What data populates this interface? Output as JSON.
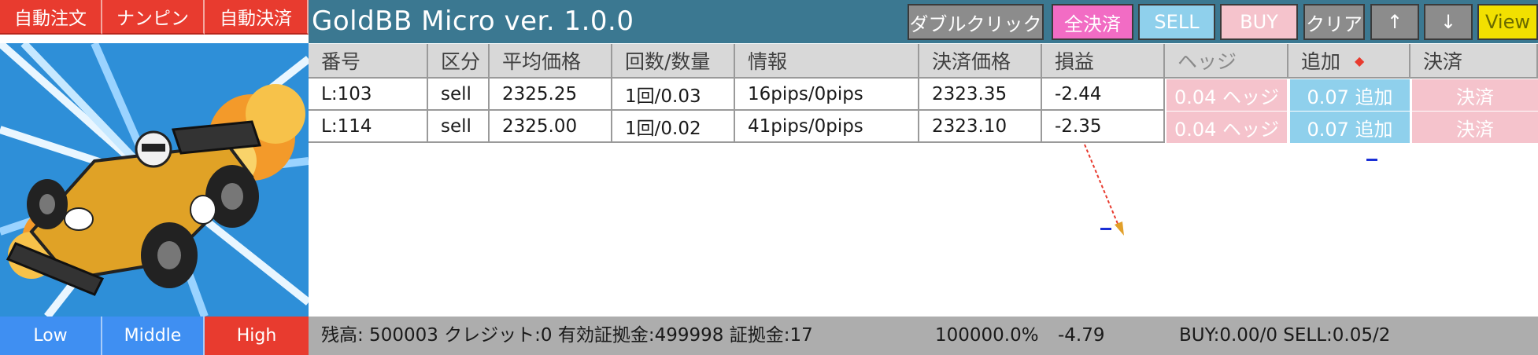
{
  "left_buttons": [
    "自動注文",
    "ナンピン",
    "自動決済"
  ],
  "title": "GoldBB Micro ver. 1.0.0",
  "toolbar": {
    "double_click": "ダブルクリック",
    "close_all": "全決済",
    "sell": "SELL",
    "buy": "BUY",
    "clear": "クリア",
    "up": "↑",
    "down": "↓",
    "view": "View"
  },
  "table": {
    "headers": [
      "番号",
      "区分",
      "平均価格",
      "回数/数量",
      "情報",
      "決済価格",
      "損益",
      "ヘッジ",
      "追加",
      "決済"
    ],
    "rows": [
      {
        "id": "L:103",
        "side": "sell",
        "avg_price": "2325.25",
        "count_qty": "1回/0.03",
        "info": "16pips/0pips",
        "close_price": "2323.35",
        "pnl": "-2.44",
        "hedge": "0.04 ヘッジ",
        "add": "0.07 追加",
        "settle": "決済"
      },
      {
        "id": "L:114",
        "side": "sell",
        "avg_price": "2325.00",
        "count_qty": "1回/0.02",
        "info": "41pips/0pips",
        "close_price": "2323.10",
        "pnl": "-2.35",
        "hedge": "0.04 ヘッジ",
        "add": "0.07 追加",
        "settle": "決済"
      }
    ]
  },
  "image_alt": "race-car-illustration",
  "modes": [
    "Low",
    "Middle",
    "High"
  ],
  "status": {
    "balance_info": "残高: 500003 クレジット:0 有効証拠金:499998 証拠金:17",
    "margin_level": "100000.0%",
    "total_pnl": "-4.79",
    "positions": "BUY:0.00/0 SELL:0.05/2"
  },
  "colors": {
    "red": "#e83b2f",
    "title_bar": "#3b7891",
    "sell_button": "#8fd0ec",
    "buy_button": "#f5c3cc",
    "close_all": "#f26cc4",
    "view": "#f2e000",
    "mode_blue": "#3f8ff2"
  }
}
